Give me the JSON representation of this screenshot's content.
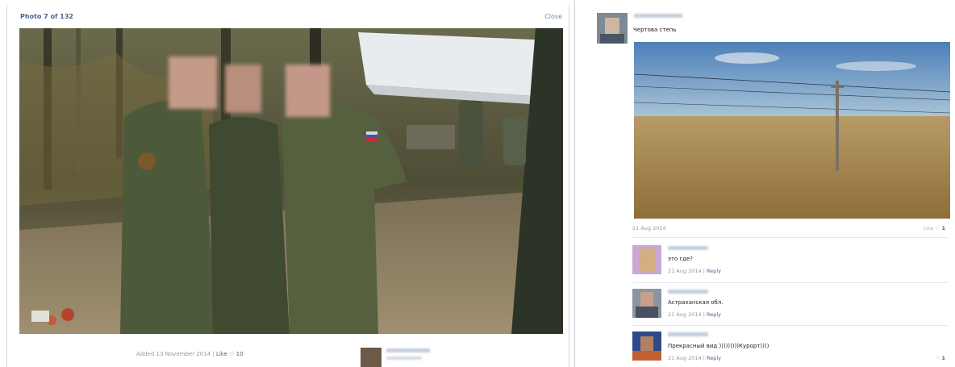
{
  "viewer": {
    "counter": "Photo 7 of 132",
    "close_label": "Close",
    "added_text": "Added 13 November 2014",
    "separator": "|",
    "like_label": "Like",
    "like_icon": "heart-icon",
    "like_count": "10"
  },
  "post": {
    "text": "Чертова степь",
    "date": "21 Aug 2014",
    "like_label": "Like",
    "like_icon": "heart-icon",
    "like_count": "1"
  },
  "comments": [
    {
      "text": "это где?",
      "date": "21 Aug 2014",
      "reply_label": "Reply"
    },
    {
      "text": "Астраханская обл.",
      "date": "21 Aug 2014",
      "reply_label": "Reply"
    },
    {
      "text": "Прекрасный вид )))))))))Курорт))))",
      "date": "21 Aug 2014",
      "reply_label": "Reply",
      "likes": "1"
    }
  ],
  "colors": {
    "link": "#45688e",
    "muted": "#999999",
    "separator": "#e7e8ec"
  }
}
